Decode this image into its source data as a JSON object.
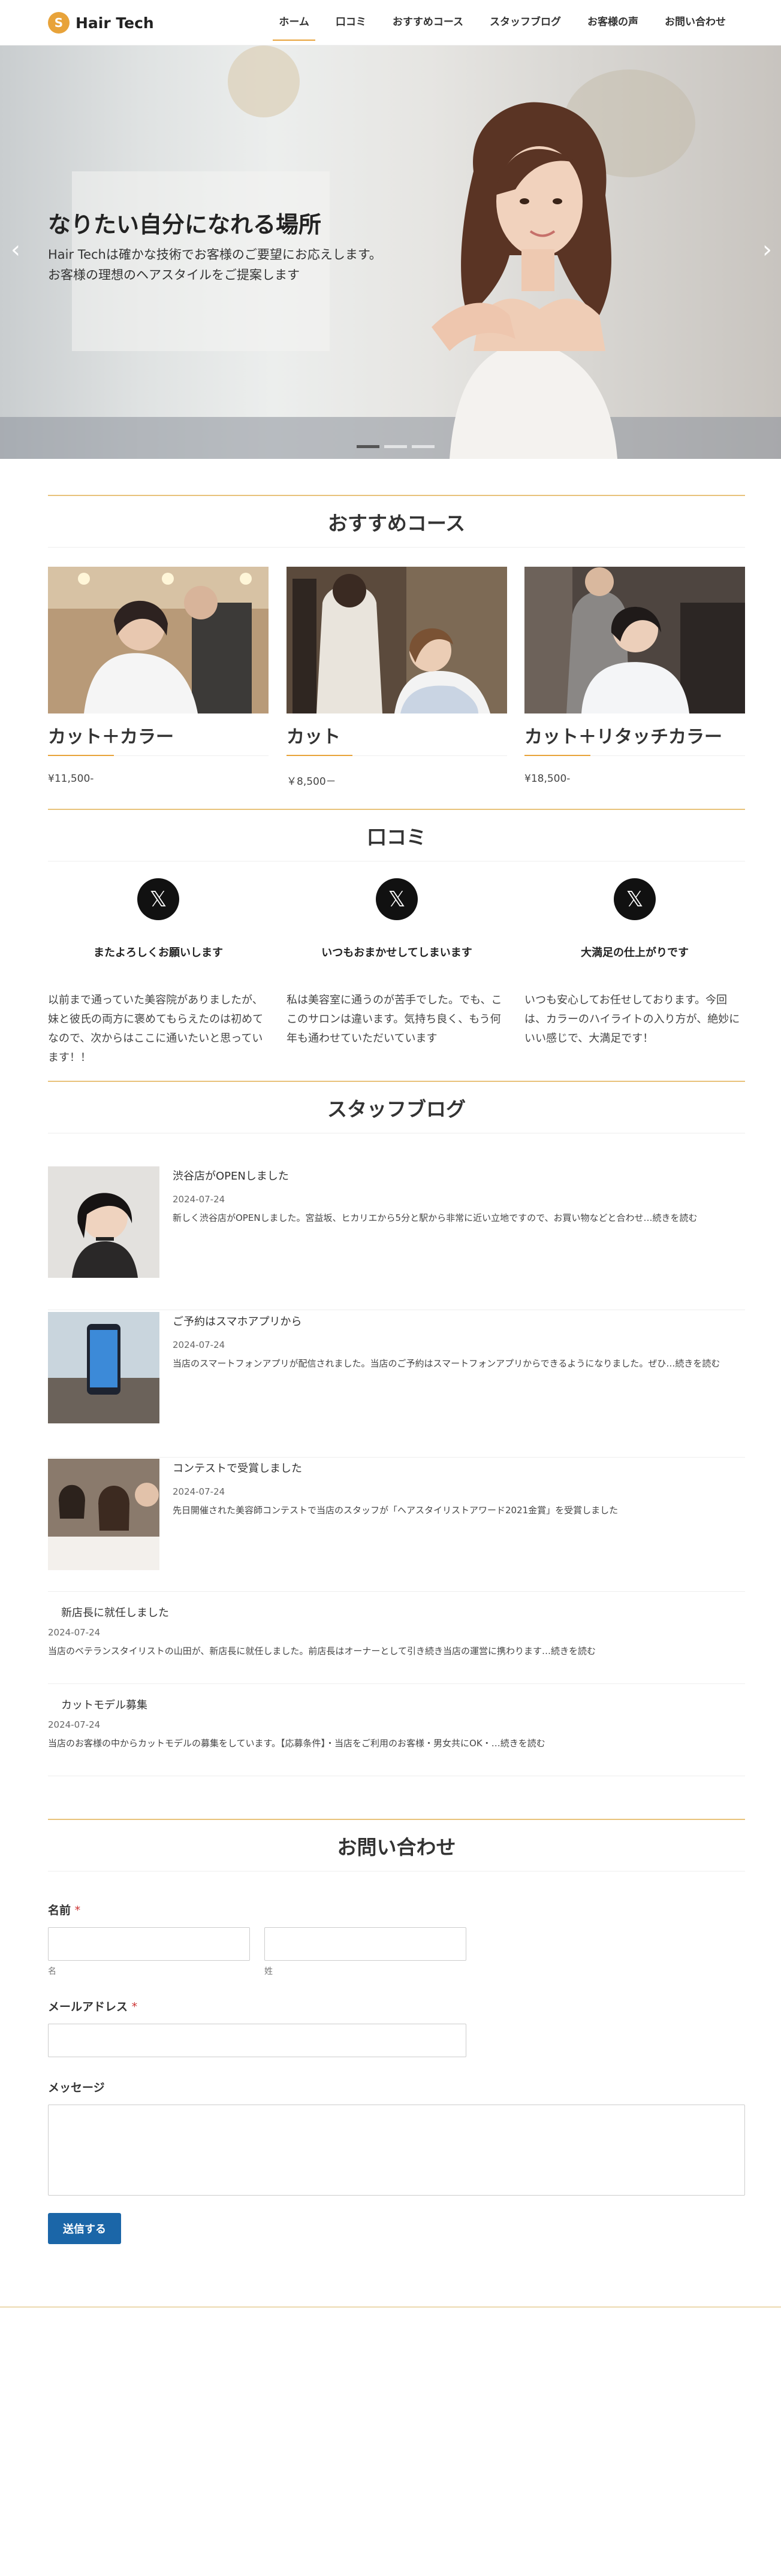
{
  "header": {
    "logo_mark": "S",
    "logo_text": "Hair Tech",
    "nav": [
      "ホーム",
      "口コミ",
      "おすすめコース",
      "スタッフブログ",
      "お客様の声",
      "お問い合わせ"
    ]
  },
  "hero": {
    "title": "なりたい自分になれる場所",
    "line1": "Hair Techは確かな技術でお客様のご要望にお応えします。",
    "line2": "お客様の理想のヘアスタイルをご提案します",
    "prev_arrow": "‹",
    "next_arrow": "›"
  },
  "courses": {
    "heading": "おすすめコース",
    "items": [
      {
        "name": "カット＋カラー",
        "price": "¥11,500-"
      },
      {
        "name": "カット",
        "price": "￥8,500－"
      },
      {
        "name": "カット＋リタッチカラー",
        "price": "¥18,500-"
      }
    ]
  },
  "reviews": {
    "heading": "口コミ",
    "icon_glyph": "𝕏",
    "items": [
      {
        "title": "またよろしくお願いします",
        "body": "以前まで通っていた美容院がありましたが、妹と彼氏の両方に褒めてもらえたのは初めてなので、次からはここに通いたいと思っています！！"
      },
      {
        "title": "いつもおまかせしてしまいます",
        "body": "私は美容室に通うのが苦手でした。でも、ここのサロンは違います。気持ち良く、もう何年も通わせていただいています"
      },
      {
        "title": "大満足の仕上がりです",
        "body": "いつも安心してお任せしております。今回は、カラーのハイライトの入り方が、絶妙にいい感じで、大満足です！"
      }
    ]
  },
  "blog": {
    "heading": "スタッフブログ",
    "posts": [
      {
        "title": "渋谷店がOPENしました",
        "date": "2024-07-24",
        "excerpt": "新しく渋谷店がOPENしました。宮益坂、ヒカリエから5分と駅から非常に近い立地ですので、お買い物などと合わせ…続きを読む"
      },
      {
        "title": "ご予約はスマホアプリから",
        "date": "2024-07-24",
        "excerpt": "当店のスマートフォンアプリが配信されました。当店のご予約はスマートフォンアプリからできるようになりました。ぜひ…続きを読む"
      },
      {
        "title": "コンテストで受賞しました",
        "date": "2024-07-24",
        "excerpt": "先日開催された美容師コンテストで当店のスタッフが「ヘアスタイリストアワード2021金賞」を受賞しました"
      },
      {
        "title": "新店長に就任しました",
        "date": "2024-07-24",
        "excerpt": "当店のベテランスタイリストの山田が、新店長に就任しました。前店長はオーナーとして引き続き当店の運営に携わります…続きを読む"
      },
      {
        "title": "カットモデル募集",
        "date": "2024-07-24",
        "excerpt": "当店のお客様の中からカットモデルの募集をしています。【応募条件】・当店をご利用のお客様・男女共にOK・…続きを読む"
      }
    ]
  },
  "contact": {
    "heading": "お問い合わせ",
    "name_label": "名前",
    "required_mark": "*",
    "first_sub": "名",
    "last_sub": "姓",
    "email_label": "メールアドレス",
    "message_label": "メッセージ",
    "submit_label": "送信する"
  }
}
